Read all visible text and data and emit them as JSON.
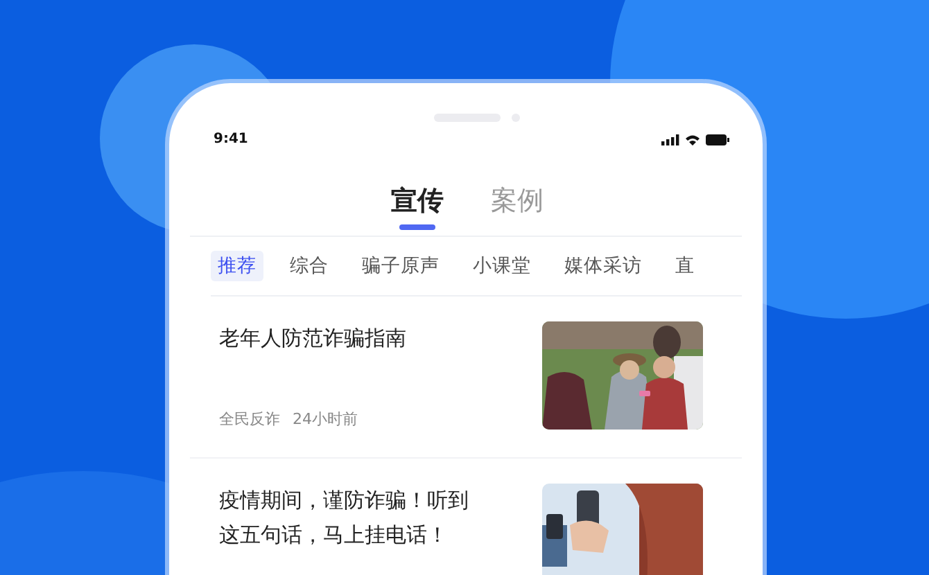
{
  "status_bar": {
    "time": "9:41"
  },
  "tabs": [
    {
      "label": "宣传",
      "selected": true
    },
    {
      "label": "案例",
      "selected": false
    }
  ],
  "categories": [
    {
      "label": "推荐",
      "selected": true
    },
    {
      "label": "综合",
      "selected": false
    },
    {
      "label": "骗子原声",
      "selected": false
    },
    {
      "label": "小课堂",
      "selected": false
    },
    {
      "label": "媒体采访",
      "selected": false
    },
    {
      "label": "直",
      "selected": false
    }
  ],
  "articles": [
    {
      "title": "老年人防范诈骗指南",
      "source": "全民反诈",
      "time": "24小时前"
    },
    {
      "title": "疫情期间，谨防诈骗！听到这五句话，马上挂电话！"
    }
  ]
}
